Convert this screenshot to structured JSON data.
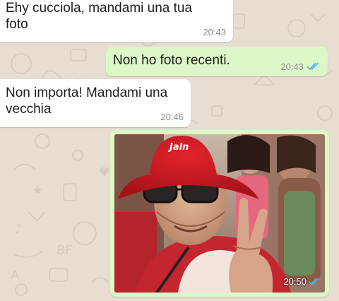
{
  "chat": {
    "messages": [
      {
        "direction": "incoming",
        "text": "Ehy cucciola, mandami una tua\nfoto",
        "time": "20:43"
      },
      {
        "direction": "outgoing",
        "text": "Non ho foto recenti.",
        "time": "20:43",
        "status": "read"
      },
      {
        "direction": "incoming",
        "text": "Non importa! Mandami una\nvecchia",
        "time": "20:46"
      },
      {
        "direction": "outgoing",
        "type": "photo",
        "time": "20:50",
        "status": "read",
        "photo_cap_text": "Jaln"
      }
    ]
  },
  "colors": {
    "chat_background": "#e7ddd1",
    "incoming_bubble": "#ffffff",
    "outgoing_bubble": "#dcf8c6",
    "read_ticks": "#4fb6ec",
    "timestamp": "#8b8b8b"
  },
  "icons": {
    "read_receipt": "double-check-icon"
  }
}
